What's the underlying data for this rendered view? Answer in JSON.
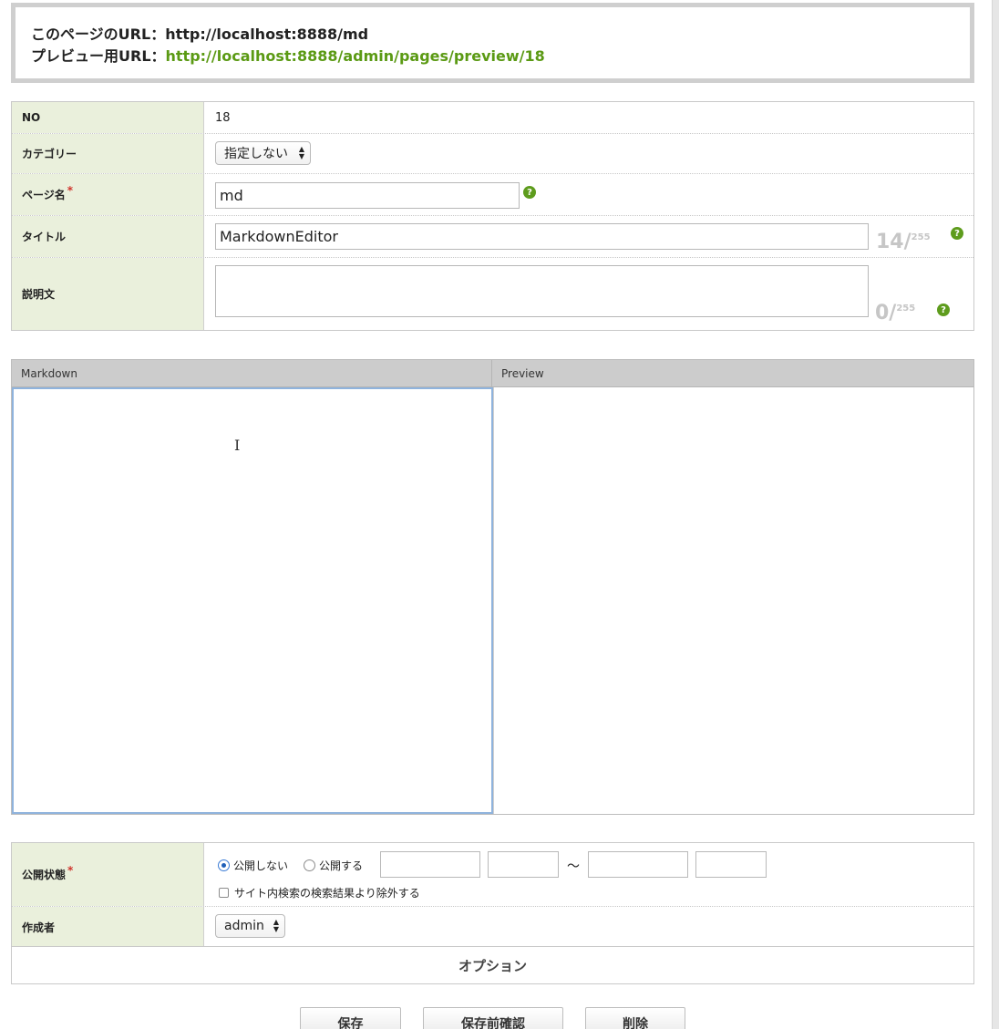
{
  "url_box": {
    "page_url_label": "このページのURL：",
    "page_url": "http://localhost:8888/md",
    "preview_url_label": "プレビュー用URL：",
    "preview_url": "http://localhost:8888/admin/pages/preview/18"
  },
  "form": {
    "no_label": "NO",
    "no_value": "18",
    "category_label": "カテゴリー",
    "category_value": "指定しない",
    "page_name_label": "ページ名",
    "page_name_value": "md",
    "title_label": "タイトル",
    "title_value": "MarkdownEditor",
    "title_count": "14/",
    "title_max": "255",
    "description_label": "説明文",
    "description_value": "",
    "description_count": "0/",
    "description_max": "255",
    "required_mark": "*",
    "help_glyph": "?"
  },
  "editor": {
    "markdown_header": "Markdown",
    "preview_header": "Preview",
    "markdown_value": ""
  },
  "publish": {
    "status_label": "公開状態",
    "radio_private": "公開しない",
    "radio_public": "公開する",
    "selected": "公開しない",
    "range_separator": "〜",
    "exclude_search_label": "サイト内検索の検索結果より除外する",
    "exclude_search_checked": false,
    "author_label": "作成者",
    "author_value": "admin"
  },
  "options": {
    "label": "オプション"
  },
  "buttons": {
    "save": "保存",
    "preview_confirm": "保存前確認",
    "delete": "削除"
  },
  "colors": {
    "link_green": "#5b9a14",
    "header_cell_bg": "#eaf0dc",
    "required_red": "#d0342c",
    "focus_blue": "#8fb3dd"
  },
  "icons": {
    "select_arrows": "updown-arrows-icon",
    "help": "help-icon",
    "cursor": "text-cursor-icon"
  }
}
